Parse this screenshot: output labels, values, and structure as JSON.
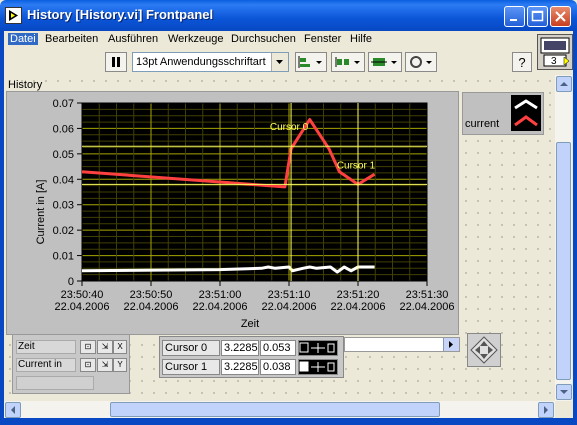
{
  "window": {
    "title": "History [History.vi] Frontpanel"
  },
  "menu": {
    "items": [
      "Datei",
      "Bearbeiten",
      "Ausführen",
      "Werkzeuge",
      "Durchsuchen",
      "Fenster",
      "Hilfe"
    ]
  },
  "toolbar": {
    "font": "13pt Anwendungsschriftart",
    "connector_count": "3",
    "help": "?"
  },
  "graph": {
    "label": "History",
    "legend_name": "current",
    "colors": {
      "plot_bg": "#000000",
      "grid": "#a6a600",
      "series": "#ff4040",
      "series2": "#ffffff",
      "cursor": "#ffff60"
    }
  },
  "chart_data": {
    "type": "line",
    "xlabel": "Zeit",
    "ylabel": "Current in [A]",
    "ylim": [
      0,
      0.07
    ],
    "y_ticks": [
      "0",
      "0.01",
      "0.02",
      "0.03",
      "0.04",
      "0.05",
      "0.06",
      "0.07"
    ],
    "x_ticks": [
      {
        "time": "23:50:40",
        "date": "22.04.2006"
      },
      {
        "time": "23:50:50",
        "date": "22.04.2006"
      },
      {
        "time": "23:51:00",
        "date": "22.04.2006"
      },
      {
        "time": "23:51:10",
        "date": "22.04.2006"
      },
      {
        "time": "23:51:20",
        "date": "22.04.2006"
      },
      {
        "time": "23:51:30",
        "date": "22.04.2006"
      }
    ],
    "xlim_seconds": [
      0,
      50
    ],
    "series": [
      {
        "name": "current",
        "color": "#ff4040",
        "x": [
          0,
          29.4,
          30.3,
          33.0,
          35.8,
          37.3,
          40.0,
          42.4
        ],
        "y": [
          0.043,
          0.037,
          0.052,
          0.0635,
          0.052,
          0.043,
          0.038,
          0.042
        ]
      },
      {
        "color": "#ffffff",
        "x": [
          0,
          20,
          26,
          27,
          28,
          30,
          30.5,
          32,
          33,
          34,
          36,
          37,
          38,
          39,
          40,
          42.4
        ],
        "y": [
          0.004,
          0.0045,
          0.005,
          0.0055,
          0.005,
          0.0055,
          0.004,
          0.005,
          0.0055,
          0.005,
          0.0055,
          0.0035,
          0.0055,
          0.004,
          0.0055,
          0.0055
        ]
      }
    ],
    "cursors": [
      {
        "name": "Cursor 0",
        "x": 30.3,
        "y": 0.053
      },
      {
        "name": "Cursor 1",
        "x": 40.0,
        "y": 0.038
      }
    ]
  },
  "scale_legend": {
    "x_name": "Zeit",
    "y_name": "Current in"
  },
  "cursor_legend": {
    "rows": [
      {
        "name": "Cursor 0",
        "x": "3.2285",
        "y": "0.053",
        "marker": "#000000"
      },
      {
        "name": "Cursor 1",
        "x": "3.2285",
        "y": "0.038",
        "marker": "#ffffff"
      }
    ]
  }
}
